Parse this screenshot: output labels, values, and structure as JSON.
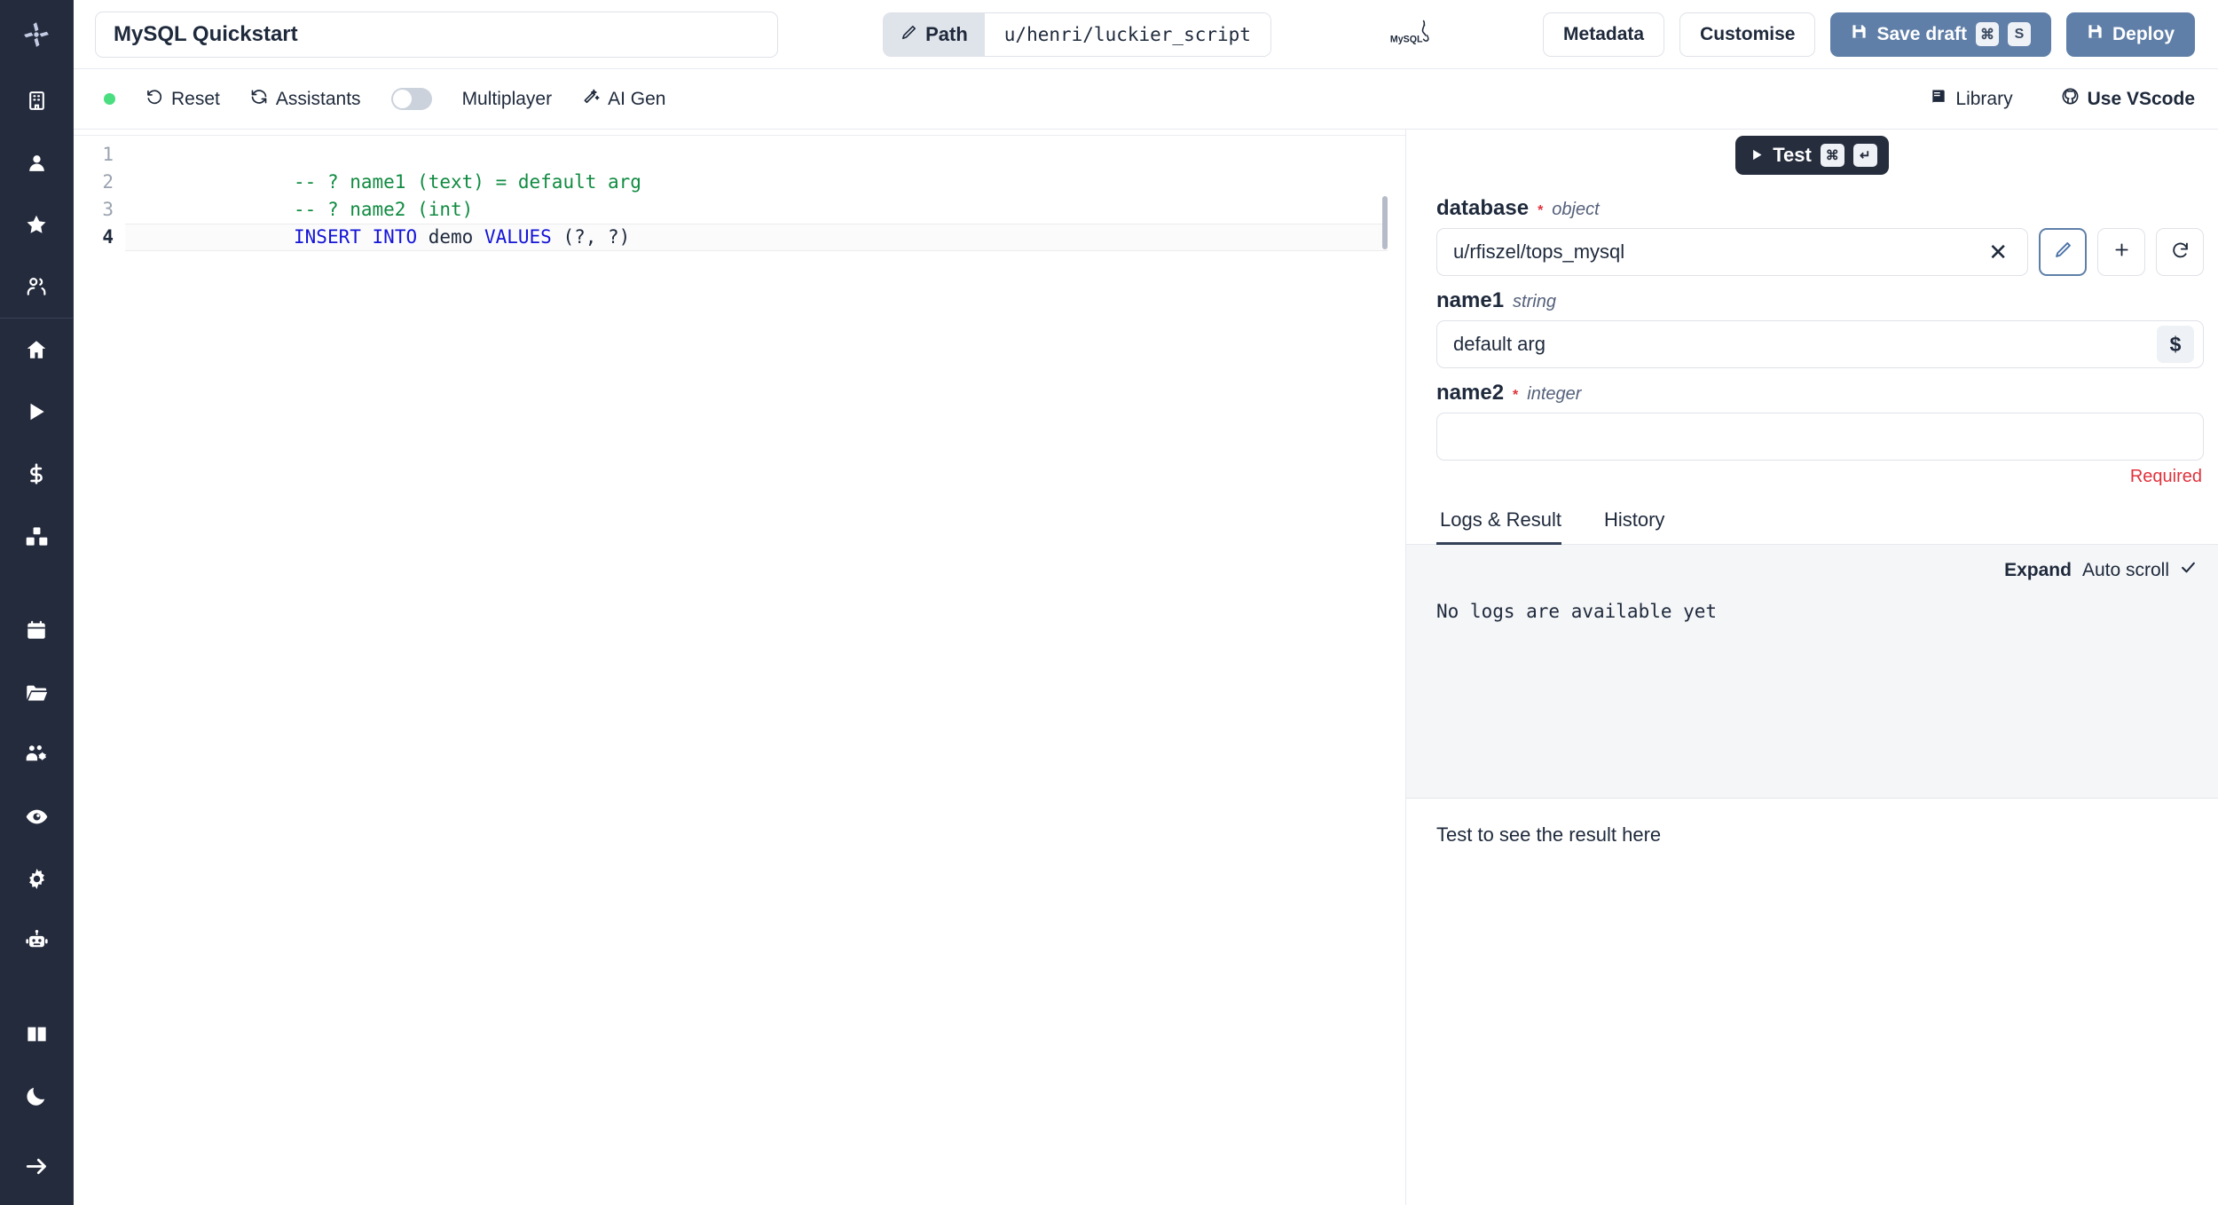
{
  "app": {
    "logo": "windmill-logo"
  },
  "sidebar": {
    "items": [
      {
        "icon": "building-icon",
        "name": "workspace"
      },
      {
        "icon": "user-icon",
        "name": "account"
      },
      {
        "icon": "star-icon",
        "name": "favorites"
      },
      {
        "icon": "users-icon",
        "name": "members"
      },
      {
        "icon": "home-icon",
        "name": "home"
      },
      {
        "icon": "play-icon",
        "name": "runs"
      },
      {
        "icon": "dollar-icon",
        "name": "usage"
      },
      {
        "icon": "boxes-icon",
        "name": "resources"
      },
      {
        "icon": "calendar-icon",
        "name": "schedules"
      },
      {
        "icon": "folder-icon",
        "name": "folders"
      },
      {
        "icon": "user-cog-icon",
        "name": "groups"
      },
      {
        "icon": "eye-icon",
        "name": "audit-logs"
      },
      {
        "icon": "gear-icon",
        "name": "settings"
      },
      {
        "icon": "robot-icon",
        "name": "workers"
      },
      {
        "icon": "book-icon",
        "name": "docs"
      },
      {
        "icon": "moon-icon",
        "name": "dark-mode"
      },
      {
        "icon": "arrow-right-icon",
        "name": "expand-sidebar"
      }
    ]
  },
  "topbar": {
    "script_title": "MySQL Quickstart",
    "script_title_placeholder": "Script name",
    "path_icon": "pencil-icon",
    "path_label": "Path",
    "path_value": "u/henri/luckier_script",
    "language_logo": "mysql-logo",
    "metadata_label": "Metadata",
    "customise_label": "Customise",
    "save_draft_label": "Save draft",
    "save_draft_icon": "save-icon",
    "save_draft_keys": [
      "⌘",
      "S"
    ],
    "deploy_label": "Deploy",
    "deploy_icon": "save-icon",
    "accent_color": "#5f7fa8"
  },
  "toolbar": {
    "status_color": "#4ade80",
    "reset_label": "Reset",
    "reset_icon": "undo-icon",
    "assistants_label": "Assistants",
    "assistants_icon": "refresh-icon",
    "multiplayer_label": "Multiplayer",
    "multiplayer_on": false,
    "ai_gen_label": "AI Gen",
    "ai_gen_icon": "wand-icon",
    "library_label": "Library",
    "library_icon": "book-icon",
    "vscode_label": "Use VScode",
    "vscode_icon": "github-icon"
  },
  "editor": {
    "active_line": 4,
    "lines": [
      {
        "number": "1",
        "tokens": [
          {
            "t": "-- ? name1 (text) = default arg",
            "c": "comment"
          }
        ]
      },
      {
        "number": "2",
        "tokens": [
          {
            "t": "-- ? name2 (int)",
            "c": "comment"
          }
        ]
      },
      {
        "number": "3",
        "tokens": [
          {
            "t": "INSERT",
            "c": "kw"
          },
          {
            "t": " ",
            "c": "plain"
          },
          {
            "t": "INTO",
            "c": "kw"
          },
          {
            "t": " demo ",
            "c": "plain"
          },
          {
            "t": "VALUES",
            "c": "kw"
          },
          {
            "t": " (?, ?)",
            "c": "plain"
          }
        ]
      },
      {
        "number": "4",
        "tokens": [
          {
            "t": "",
            "c": "plain"
          }
        ]
      }
    ]
  },
  "test_panel": {
    "test_label": "Test",
    "test_icon": "play-icon",
    "test_keys": [
      "⌘",
      "↵"
    ],
    "args": [
      {
        "name": "database",
        "required": true,
        "type": "object",
        "value": "u/rfiszel/tops_mysql",
        "clear_icon": "close-icon",
        "actions": [
          {
            "icon": "pencil-icon",
            "name": "edit-resource-button",
            "selected": true
          },
          {
            "icon": "plus-icon",
            "name": "add-resource-button",
            "selected": false
          },
          {
            "icon": "refresh-icon",
            "name": "refresh-resources-button",
            "selected": false
          }
        ]
      },
      {
        "name": "name1",
        "required": false,
        "type": "string",
        "value": "default arg",
        "suffix_chip": "$"
      },
      {
        "name": "name2",
        "required": true,
        "type": "integer",
        "value": "",
        "error": "Required"
      }
    ]
  },
  "results": {
    "tabs": [
      {
        "label": "Logs & Result",
        "active": true
      },
      {
        "label": "History",
        "active": false
      }
    ],
    "expand_label": "Expand",
    "auto_scroll_label": "Auto scroll",
    "auto_scroll_checked": true,
    "check_icon": "check-icon",
    "logs_empty": "No logs are available yet",
    "result_empty": "Test to see the result here"
  }
}
